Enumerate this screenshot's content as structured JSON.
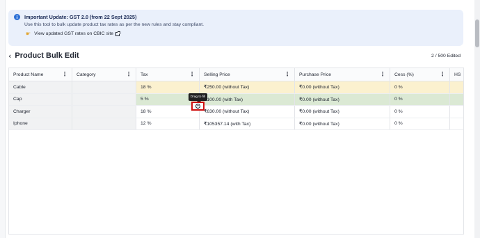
{
  "banner": {
    "title": "Important Update: GST 2.0 (from 22 Sept 2025)",
    "subtitle": "Use this tool to bulk update product tax rates as per the new rules and stay compliant.",
    "link_text": "View updated GST rates on CBIC site"
  },
  "header": {
    "title": "Product Bulk Edit",
    "edited_count": "2 / 500 Edited"
  },
  "table": {
    "columns": [
      "Product Name",
      "Category",
      "Tax",
      "Selling Price",
      "Purchase Price",
      "Cess (%)",
      "HS"
    ],
    "rows": [
      {
        "product_name": "Cable",
        "category": "",
        "tax": "18 %",
        "selling_price": "₹250.00 (without Tax)",
        "purchase_price": "₹0.00 (without Tax)",
        "cess": "0 %"
      },
      {
        "product_name": "Cap",
        "category": "",
        "tax": "5 %",
        "selling_price": "₹100.00 (with Tax)",
        "purchase_price": "₹0.00 (without Tax)",
        "cess": "0 %"
      },
      {
        "product_name": "Charger",
        "category": "",
        "tax": "18 %",
        "selling_price": "₹630.00 (without Tax)",
        "purchase_price": "₹0.00 (without Tax)",
        "cess": "0 %"
      },
      {
        "product_name": "Iphone",
        "category": "",
        "tax": "12 %",
        "selling_price": "₹105357.14 (with Tax)",
        "purchase_price": "₹0.00 (without Tax)",
        "cess": "0 %"
      }
    ]
  },
  "tooltip": {
    "text": "Drag to fill"
  },
  "icons": {
    "info": "info-icon",
    "hand": "pointing-hand-icon",
    "external_link": "external-link-icon",
    "back": "chevron-left-icon",
    "column_menu": "kebab-menu-icon",
    "fill_handle": "drag-fill-icon"
  },
  "colors": {
    "banner_bg": "#eaf0fb",
    "info_blue": "#2a6fd6",
    "edited_yellow": "#fbf1cf",
    "edited_green": "#dbe9d4",
    "highlight_red": "#d01010"
  }
}
